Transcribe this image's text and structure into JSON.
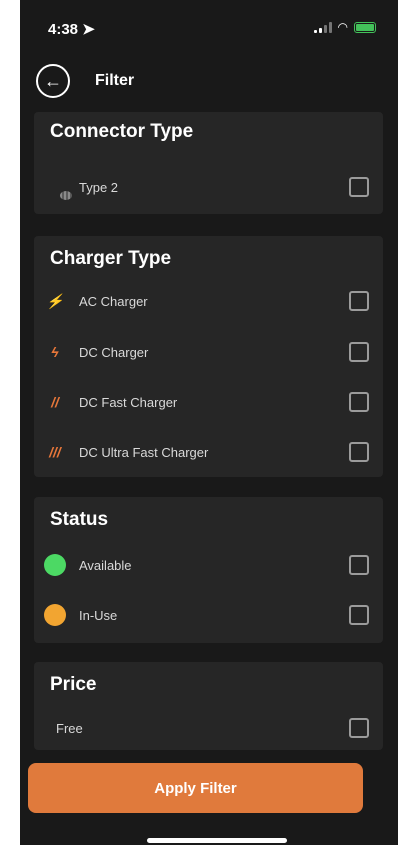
{
  "status_bar": {
    "time": "4:38"
  },
  "header": {
    "title": "Filter",
    "back_icon": "arrow-left-icon"
  },
  "connector_type": {
    "title": "Connector Type",
    "items": [
      {
        "label": "Type 2",
        "icon": "type2-plug-icon",
        "checked": false
      }
    ]
  },
  "charger_type": {
    "title": "Charger Type",
    "accent": "#e8773a",
    "items": [
      {
        "label": "AC Charger",
        "icon": "⚡",
        "checked": false
      },
      {
        "label": "DC Charger",
        "icon": "ϟ",
        "checked": false
      },
      {
        "label": "DC Fast Charger",
        "icon": "//",
        "checked": false
      },
      {
        "label": "DC Ultra Fast Charger",
        "icon": "///",
        "checked": false
      }
    ]
  },
  "status": {
    "title": "Status",
    "items": [
      {
        "label": "Available",
        "color": "#4cd964",
        "checked": false
      },
      {
        "label": "In-Use",
        "color": "#f2a531",
        "checked": false
      }
    ]
  },
  "price": {
    "title": "Price",
    "items": [
      {
        "label": "Free",
        "checked": false
      }
    ]
  },
  "apply_button": {
    "label": "Apply Filter",
    "color": "#e07a3c"
  }
}
